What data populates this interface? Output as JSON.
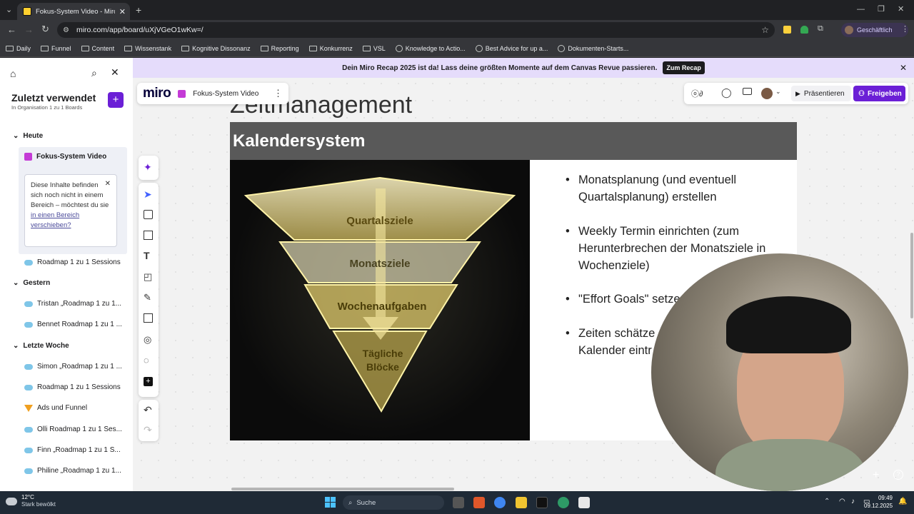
{
  "browser": {
    "tab_title": "Fokus-System Video - Miro",
    "url": "miro.com/app/board/uXjVGeO1wKw=/",
    "profile_label": "Geschäftlich",
    "bookmarks": [
      "Daily",
      "Funnel",
      "Content",
      "Wissenstank",
      "Kognitive Dissonanz",
      "Reporting",
      "Konkurrenz",
      "VSL",
      "Knowledge to Actio...",
      "Best Advice for up a...",
      "Dokumenten-Starts..."
    ]
  },
  "banner": {
    "text": "Dein Miro Recap 2025 ist da! Lass deine größten Momente auf dem Canvas Revue passieren.",
    "button": "Zum Recap"
  },
  "sidebar": {
    "title": "Zuletzt verwendet",
    "subtitle": "In Organisation 1 zu 1 Boards",
    "sections": {
      "today": "Heute",
      "yesterday": "Gestern",
      "last_week": "Letzte Woche"
    },
    "active_item": "Fokus-System Video",
    "notice": {
      "text": "Diese Inhalte befinden sich noch nicht in einem Bereich – möchtest du sie",
      "link": "in einen Bereich verschieben?"
    },
    "items_today": [
      "Roadmap 1 zu 1 Sessions"
    ],
    "items_yesterday": [
      "Tristan „Roadmap 1 zu 1...",
      "Bennet Roadmap 1 zu 1 ..."
    ],
    "items_last_week": [
      "Simon „Roadmap 1 zu 1 ...",
      "Roadmap 1 zu 1 Sessions",
      "Ads und Funnel",
      "Olli Roadmap 1 zu 1 Ses...",
      "Finn „Roadmap 1 zu 1 S...",
      "Philine „Roadmap 1 zu 1..."
    ]
  },
  "board": {
    "logo": "miro",
    "name": "Fokus-System Video",
    "present": "Präsentieren",
    "share": "Freigeben",
    "heading": "Zeitmanagement",
    "slide_title": "Kalendersystem",
    "pyramid": [
      "Quartalsziele",
      "Monatsziele",
      "Wochenaufgaben",
      "Tägliche Blöcke"
    ],
    "bullets": [
      " Monatsplanung (und eventuell Quartalsplanung) erstellen",
      "Weekly Termin einrichten (zum Herunterbrechen der Monatsziele in Wochenziele)",
      "\"Effort Goals\" setze",
      "Zeiten schätze Kalender eintr"
    ]
  },
  "taskbar": {
    "weather_temp": "12°C",
    "weather_desc": "Stark bewölkt",
    "search": "Suche",
    "time": "09:49",
    "date": "09.12.2025"
  },
  "colors": {
    "accent": "#4262ff",
    "miro_purple": "#6b1fd6",
    "banner": "#e5dcfb",
    "slide_header": "#595959"
  }
}
